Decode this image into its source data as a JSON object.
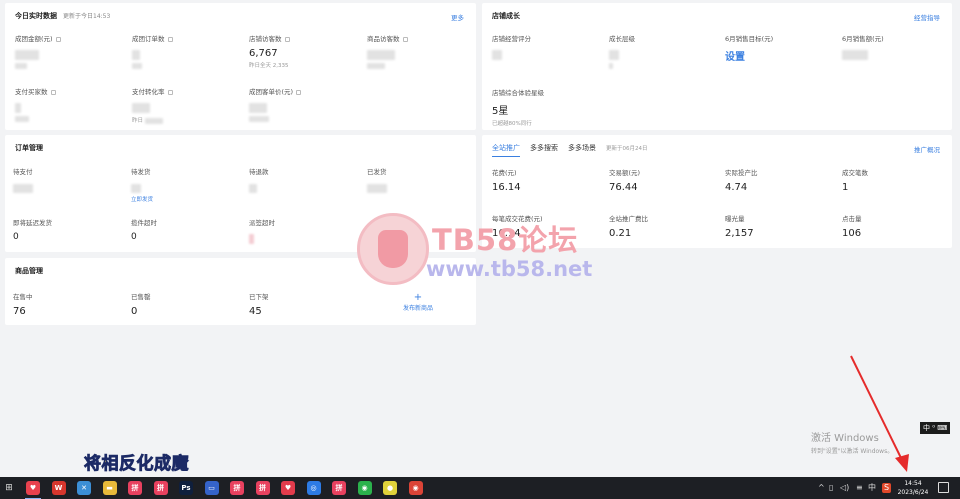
{
  "realtime": {
    "title": "今日实时数据",
    "updated": "更新于今日14:53",
    "more": "更多",
    "metrics": [
      {
        "label": "成团金额(元)"
      },
      {
        "label": "成团订单数"
      },
      {
        "label": "店铺访客数",
        "value": "6,767",
        "foot": "昨日全天 2,335"
      },
      {
        "label": "商品访客数"
      },
      {
        "label": "支付买家数"
      },
      {
        "label": "支付转化率",
        "foot": "昨日"
      },
      {
        "label": "成团客单价(元)"
      }
    ]
  },
  "growth": {
    "title": "店铺成长",
    "link": "经营指导",
    "metrics": [
      {
        "label": "店铺经营评分"
      },
      {
        "label": "成长层级"
      },
      {
        "label": "6月销售目标(元)",
        "value": "设置"
      },
      {
        "label": "6月销售额(元)"
      }
    ],
    "experience": {
      "label": "店铺综合体验星级",
      "value": "5星",
      "foot": "已超越80%同行"
    }
  },
  "orders": {
    "title": "订单管理",
    "metrics": [
      {
        "label": "待支付"
      },
      {
        "label": "待发货",
        "link": "立即发货"
      },
      {
        "label": "待退款"
      },
      {
        "label": "已发货"
      },
      {
        "label": "即将延迟发货",
        "value": "0"
      },
      {
        "label": "揽件超时",
        "value": "0"
      },
      {
        "label": "派签超时"
      }
    ]
  },
  "promo": {
    "tabs": [
      "全站推广",
      "多多搜索",
      "多多场景"
    ],
    "updated": "更新于06月24日",
    "link": "推广概况",
    "metrics": [
      {
        "label": "花费(元)",
        "value": "16.14"
      },
      {
        "label": "交易额(元)",
        "value": "76.44"
      },
      {
        "label": "实际投产比",
        "value": "4.74"
      },
      {
        "label": "成交笔数",
        "value": "1"
      },
      {
        "label": "每笔成交花费(元)",
        "value": "16.14"
      },
      {
        "label": "全站推广费比",
        "value": "0.21"
      },
      {
        "label": "曝光量",
        "value": "2,157"
      },
      {
        "label": "点击量",
        "value": "106"
      }
    ]
  },
  "products": {
    "title": "商品管理",
    "metrics": [
      {
        "label": "在售中",
        "value": "76"
      },
      {
        "label": "已售罄",
        "value": "0"
      },
      {
        "label": "已下架",
        "value": "45"
      }
    ],
    "publish_plus": "+",
    "publish_label": "发布新商品"
  },
  "watermark": {
    "title": "TB58论坛",
    "url": "www.tb58.net"
  },
  "subtitle": "将相反化成魔",
  "activation": {
    "line1": "激活 Windows",
    "line2": "转到\"设置\"以激活 Windows。"
  },
  "ime": "中 ⁰ ⌨",
  "taskbar": {
    "start": "⊞",
    "apps": [
      {
        "name": "favorites-icon",
        "glyph": "♥",
        "color": "#e8414e"
      },
      {
        "name": "wps-icon",
        "glyph": "W",
        "color": "#d7362d"
      },
      {
        "name": "vpn-icon",
        "glyph": "✕",
        "color": "#3c8fd6"
      },
      {
        "name": "file-explorer-icon",
        "glyph": "▬",
        "color": "#e7b93a"
      },
      {
        "name": "pdd-merchant-icon",
        "glyph": "拼",
        "color": "#e8415f"
      },
      {
        "name": "pdd-merchant-icon",
        "glyph": "拼",
        "color": "#e8415f"
      },
      {
        "name": "photoshop-icon",
        "glyph": "Ps",
        "color": "#0f1f3d"
      },
      {
        "name": "monitor-icon",
        "glyph": "▭",
        "color": "#3563c9"
      },
      {
        "name": "pdd-merchant-icon",
        "glyph": "拼",
        "color": "#e8415f"
      },
      {
        "name": "pdd-merchant-icon",
        "glyph": "拼",
        "color": "#e8415f"
      },
      {
        "name": "heart-app-icon",
        "glyph": "♥",
        "color": "#e23b4c"
      },
      {
        "name": "browser-icon",
        "glyph": "◎",
        "color": "#2d7be5"
      },
      {
        "name": "pdd-merchant-icon",
        "glyph": "拼",
        "color": "#e8415f"
      },
      {
        "name": "wechat-icon",
        "glyph": "◉",
        "color": "#2bb24c"
      },
      {
        "name": "game-icon",
        "glyph": "●",
        "color": "#e0d23b"
      },
      {
        "name": "chrome-icon",
        "glyph": "◉",
        "color": "#db4437"
      }
    ],
    "tray": [
      "^",
      "▯",
      "◁)",
      "≡",
      "中",
      "S"
    ],
    "time": "14:54",
    "date": "2023/6/24"
  }
}
